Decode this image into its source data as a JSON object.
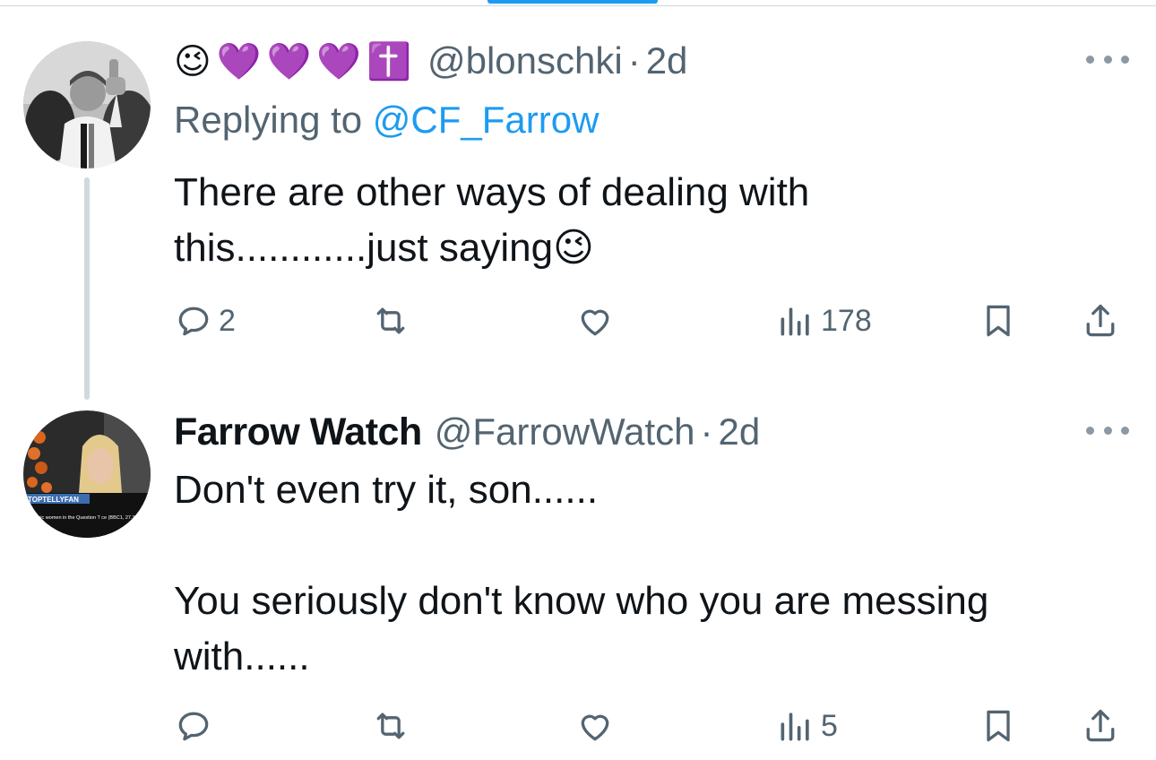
{
  "tweets": [
    {
      "display_name": "",
      "name_emojis": [
        "😉",
        "💜",
        "💜",
        "💜",
        "✝️"
      ],
      "handle": "@blonschki",
      "separator": "·",
      "time": "2d",
      "replying_prefix": "Replying to",
      "replying_to": "@CF_Farrow",
      "text": "There are other ways of dealing with\nthis............just saying😉",
      "reply_count": "2",
      "retweet_count": "",
      "like_count": "",
      "view_count": "178"
    },
    {
      "display_name": "Farrow Watch",
      "handle": "@FarrowWatch",
      "separator": "·",
      "time": "2d",
      "text": "Don't even try it, son......\n\nYou seriously don't know who you are messing\nwith......",
      "reply_count": "",
      "retweet_count": "",
      "like_count": "",
      "view_count": "5",
      "avatar_caption": "TOPTELLYFAN",
      "avatar_subcaption": "ophobic women in the Question T ce (BBC1, 27.3.14)"
    }
  ],
  "icons": {
    "reply": "reply-icon",
    "retweet": "retweet-icon",
    "like": "heart-icon",
    "views": "views-icon",
    "bookmark": "bookmark-icon",
    "share": "share-icon",
    "more": "more-icon"
  },
  "colors": {
    "accent": "#1d9bf0",
    "secondary_text": "#536471",
    "thread_line": "#cfd9de"
  }
}
